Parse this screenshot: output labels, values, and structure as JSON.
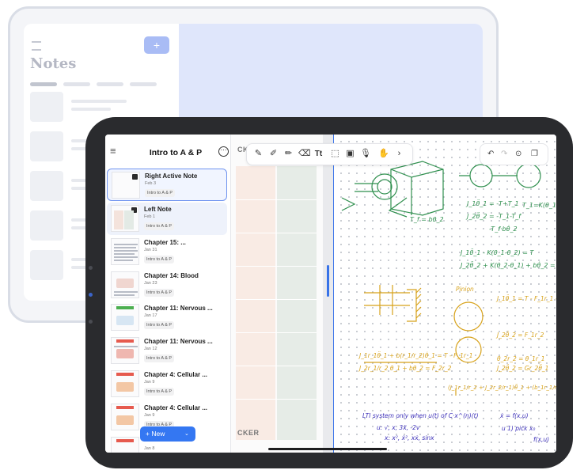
{
  "background_app": {
    "title": "Notes",
    "add_button": "+"
  },
  "sidebar": {
    "title": "Intro to A & P",
    "new_button": "+ New",
    "notes": [
      {
        "title": "Right Active Note",
        "date": "Feb 3",
        "tag": "Intro to A & P",
        "state": "active"
      },
      {
        "title": "Left Note",
        "date": "Feb 1",
        "tag": "Intro to A & P",
        "state": "selected"
      },
      {
        "title": "Chapter 15: ...",
        "date": "Jan 31",
        "tag": "Intro to A & P",
        "state": "normal"
      },
      {
        "title": "Chapter 14: Blood",
        "date": "Jan 23",
        "tag": "Intro to A & P",
        "state": "normal"
      },
      {
        "title": "Chapter 11: Nervous ...",
        "date": "Jan 17",
        "tag": "Intro to A & P",
        "state": "normal"
      },
      {
        "title": "Chapter 11: Nervous ...",
        "date": "Jan 12",
        "tag": "Intro to A & P",
        "state": "normal"
      },
      {
        "title": "Chapter 4: Cellular ...",
        "date": "Jan 9",
        "tag": "Intro to A & P",
        "state": "normal"
      },
      {
        "title": "Chapter 4: Cellular ...",
        "date": "Jan 9",
        "tag": "Intro to A & P",
        "state": "normal"
      },
      {
        "title": "",
        "date": "Jan 8",
        "tag": "",
        "state": "normal"
      }
    ]
  },
  "middle_pane": {
    "header_top": "CKER",
    "header_bottom": "CKER"
  },
  "toolbar": {
    "tools": [
      "pen-icon",
      "pencil-icon",
      "highlighter-icon",
      "eraser-icon",
      "text-icon",
      "lasso-icon",
      "image-icon",
      "mic-icon",
      "hand-icon",
      "more-tools-icon"
    ],
    "text_tool_label": "Tt"
  },
  "handwriting": {
    "eq1": "J_1θ̈_1 = -T+T_1",
    "eq2": "J_2θ̈_2 = -T_1-T_f",
    "eq3": "-T_f·bθ̇_2",
    "eq4": "T_1=K(θ_1-θ_2)",
    "eq5": "J_1θ̈_1 - K(θ_1-θ_2) = T",
    "eq6": "J_2θ̈_2 + K(θ_2-θ_1) + bθ̇_2 = 0",
    "label_tf": "T_f = bθ_2",
    "label_pinion": "Pinion",
    "eq7": "J_1θ̈_1 = T - F_1r_1 - bθ̇_1",
    "eq8": "J_2θ̈_2 = F_1r_2",
    "eq9": "θ_2r_2 = θ_1r_1",
    "eq10": "J_2θ̈_2 = Gr_2θ̈_1",
    "eq11": "J_1r_1θ̈_1 + b(r_1/r_2)θ̇_1 = T - F_1r_1",
    "eq12": "J_2r_1/r_2 θ_1 + bθ_2 = F_2r_2",
    "eq13": "(J_1r_1/r_2 + J_2r_2/r_1)θ̈_1 + (b_1r_1/r_2 + b_2r_2/r_1)θ̇_1 = T",
    "eq14": "LTI system only when u(t) of C·x^(n)(t)",
    "eq15": "u: √, x, 3ẍ, -2v",
    "eq16": "x: x², ẋ², xẋ, sinx",
    "eq17": "ẋ = f(x,u)",
    "eq18": "u  1)  pick x₀",
    "eq19": "f(x,u)"
  }
}
